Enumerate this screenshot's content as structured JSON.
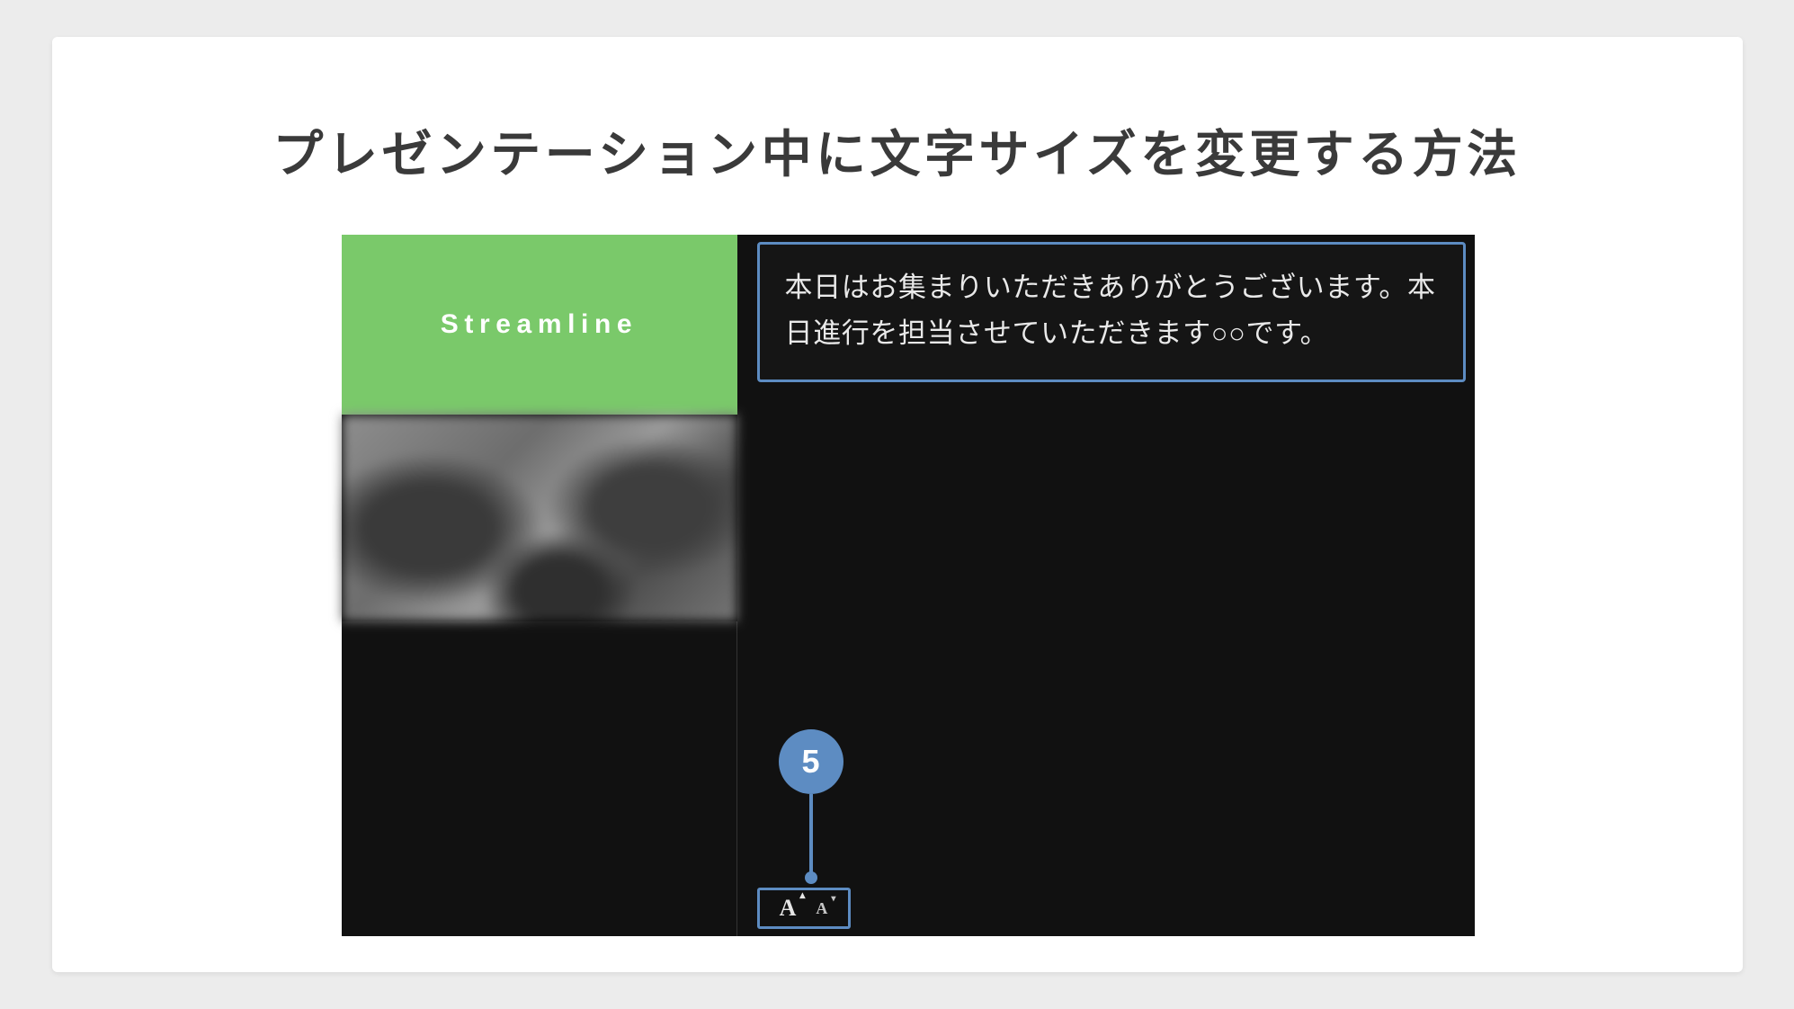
{
  "heading": "プレゼンテーション中に文字サイズを変更する方法",
  "thumbnail": {
    "title": "Streamline"
  },
  "notes": {
    "text": "本日はお集まりいただきありがとうございます。本日進行を担当させていただきます○○です。"
  },
  "toolbar": {
    "increase_label": "A",
    "decrease_label": "A"
  },
  "callout": {
    "number": "5"
  },
  "colors": {
    "accent_green": "#7ac96a",
    "accent_blue": "#5d8cc2"
  }
}
